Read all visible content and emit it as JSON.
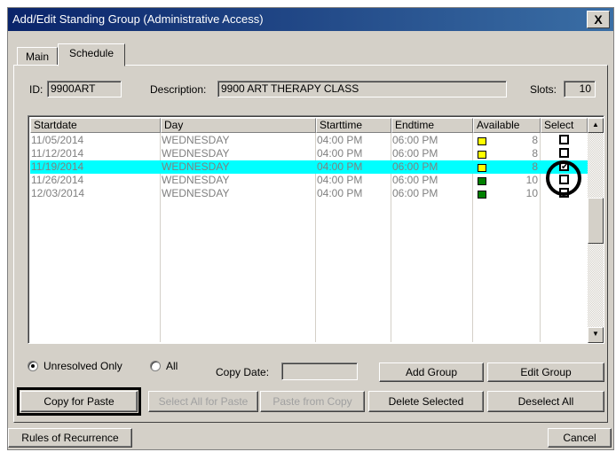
{
  "window": {
    "title": "Add/Edit Standing Group (Administrative Access)",
    "close_label": "X"
  },
  "tabs": [
    {
      "label": "Main",
      "active": false
    },
    {
      "label": "Schedule",
      "active": true
    }
  ],
  "header": {
    "id_label": "ID:",
    "id_value": "9900ART",
    "description_label": "Description:",
    "description_value": "9900 ART THERAPY CLASS",
    "slots_label": "Slots:",
    "slots_value": "10"
  },
  "grid": {
    "columns": [
      "Startdate",
      "Day",
      "Starttime",
      "Endtime",
      "Available",
      "Select"
    ],
    "rows": [
      {
        "startdate": "11/05/2014",
        "day": "WEDNESDAY",
        "starttime": "04:00 PM",
        "endtime": "06:00 PM",
        "available": "8",
        "status_color": "#ffff00",
        "selected": false,
        "highlighted": false
      },
      {
        "startdate": "11/12/2014",
        "day": "WEDNESDAY",
        "starttime": "04:00 PM",
        "endtime": "06:00 PM",
        "available": "8",
        "status_color": "#ffff00",
        "selected": false,
        "highlighted": false
      },
      {
        "startdate": "11/19/2014",
        "day": "WEDNESDAY",
        "starttime": "04:00 PM",
        "endtime": "06:00 PM",
        "available": "8",
        "status_color": "#ffff00",
        "selected": true,
        "highlighted": true
      },
      {
        "startdate": "11/26/2014",
        "day": "WEDNESDAY",
        "starttime": "04:00 PM",
        "endtime": "06:00 PM",
        "available": "10",
        "status_color": "#008000",
        "selected": false,
        "highlighted": false
      },
      {
        "startdate": "12/03/2014",
        "day": "WEDNESDAY",
        "starttime": "04:00 PM",
        "endtime": "06:00 PM",
        "available": "10",
        "status_color": "#008000",
        "selected": false,
        "highlighted": false
      }
    ],
    "highlight_color": "#00ffff"
  },
  "filter": {
    "unresolved_label": "Unresolved Only",
    "all_label": "All",
    "selected": "unresolved",
    "copy_date_label": "Copy Date:",
    "copy_date_value": ""
  },
  "buttons": {
    "add_group": "Add Group",
    "edit_group": "Edit Group",
    "copy_for_paste": "Copy for Paste",
    "select_all_for_paste": "Select All for Paste",
    "paste_from_copy": "Paste from Copy",
    "delete_selected": "Delete Selected",
    "deselect_all": "Deselect All",
    "rules_of_recurrence": "Rules of Recurrence",
    "cancel": "Cancel"
  },
  "icons": {
    "scroll_up": "scroll-up-arrow-icon",
    "scroll_down": "scroll-down-arrow-icon",
    "checkmark": "✔"
  }
}
